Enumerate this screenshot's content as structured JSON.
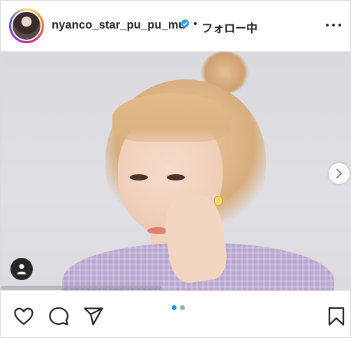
{
  "header": {
    "username": "nyanco_star_pu_pu_mu",
    "separator": "•",
    "follow_status": "フォロー中",
    "more_icon": "more-horizontal-icon",
    "verified_icon": "verified-badge-icon"
  },
  "carousel": {
    "current_index": 1,
    "total": 2
  },
  "actions": {
    "like_icon": "heart-icon",
    "comment_icon": "comment-icon",
    "share_icon": "paper-plane-icon",
    "save_icon": "bookmark-icon"
  },
  "colors": {
    "accent_blue": "#0095f6",
    "text": "#262626",
    "inactive_dot": "#a8a8a8"
  }
}
